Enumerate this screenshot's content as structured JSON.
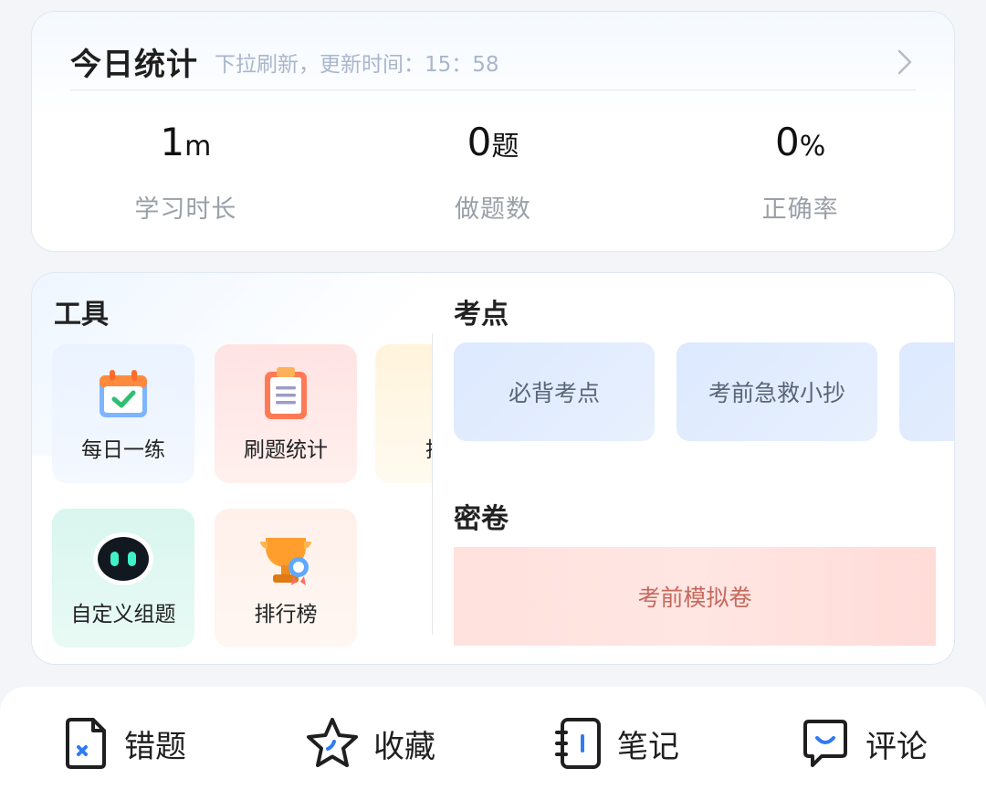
{
  "stats": {
    "title": "今日统计",
    "subtitle": "下拉刷新，更新时间：15：58",
    "items": [
      {
        "value": "1",
        "unit": "m",
        "label": "学习时长"
      },
      {
        "value": "0",
        "unit": "题",
        "label": "做题数"
      },
      {
        "value": "0",
        "unit": "%",
        "label": "正确率"
      }
    ]
  },
  "tools": {
    "title": "工具",
    "items": [
      {
        "label": "每日一练",
        "icon": "calendar-check-icon"
      },
      {
        "label": "刷题统计",
        "icon": "clipboard-icon"
      },
      {
        "label": "择校",
        "icon": "school-icon"
      },
      {
        "label": "自定义组题",
        "icon": "robot-icon"
      },
      {
        "label": "排行榜",
        "icon": "trophy-icon"
      }
    ]
  },
  "points": {
    "title": "考点",
    "items": [
      {
        "label": "必背考点"
      },
      {
        "label": "考前急救小抄"
      },
      {
        "label": ""
      }
    ]
  },
  "papers": {
    "title": "密卷",
    "items": [
      {
        "label": "考前模拟卷"
      }
    ]
  },
  "bottom_bar": {
    "items": [
      {
        "label": "错题",
        "icon": "wrong-question-icon"
      },
      {
        "label": "收藏",
        "icon": "star-icon"
      },
      {
        "label": "笔记",
        "icon": "notebook-icon"
      },
      {
        "label": "评论",
        "icon": "comment-icon"
      }
    ]
  },
  "colors": {
    "accent_blue": "#2f7bf6",
    "text_dark": "#222222",
    "text_gray": "#9aa0a8",
    "subtitle": "#a9b6cc",
    "exam_paper_text": "#c5695d"
  }
}
